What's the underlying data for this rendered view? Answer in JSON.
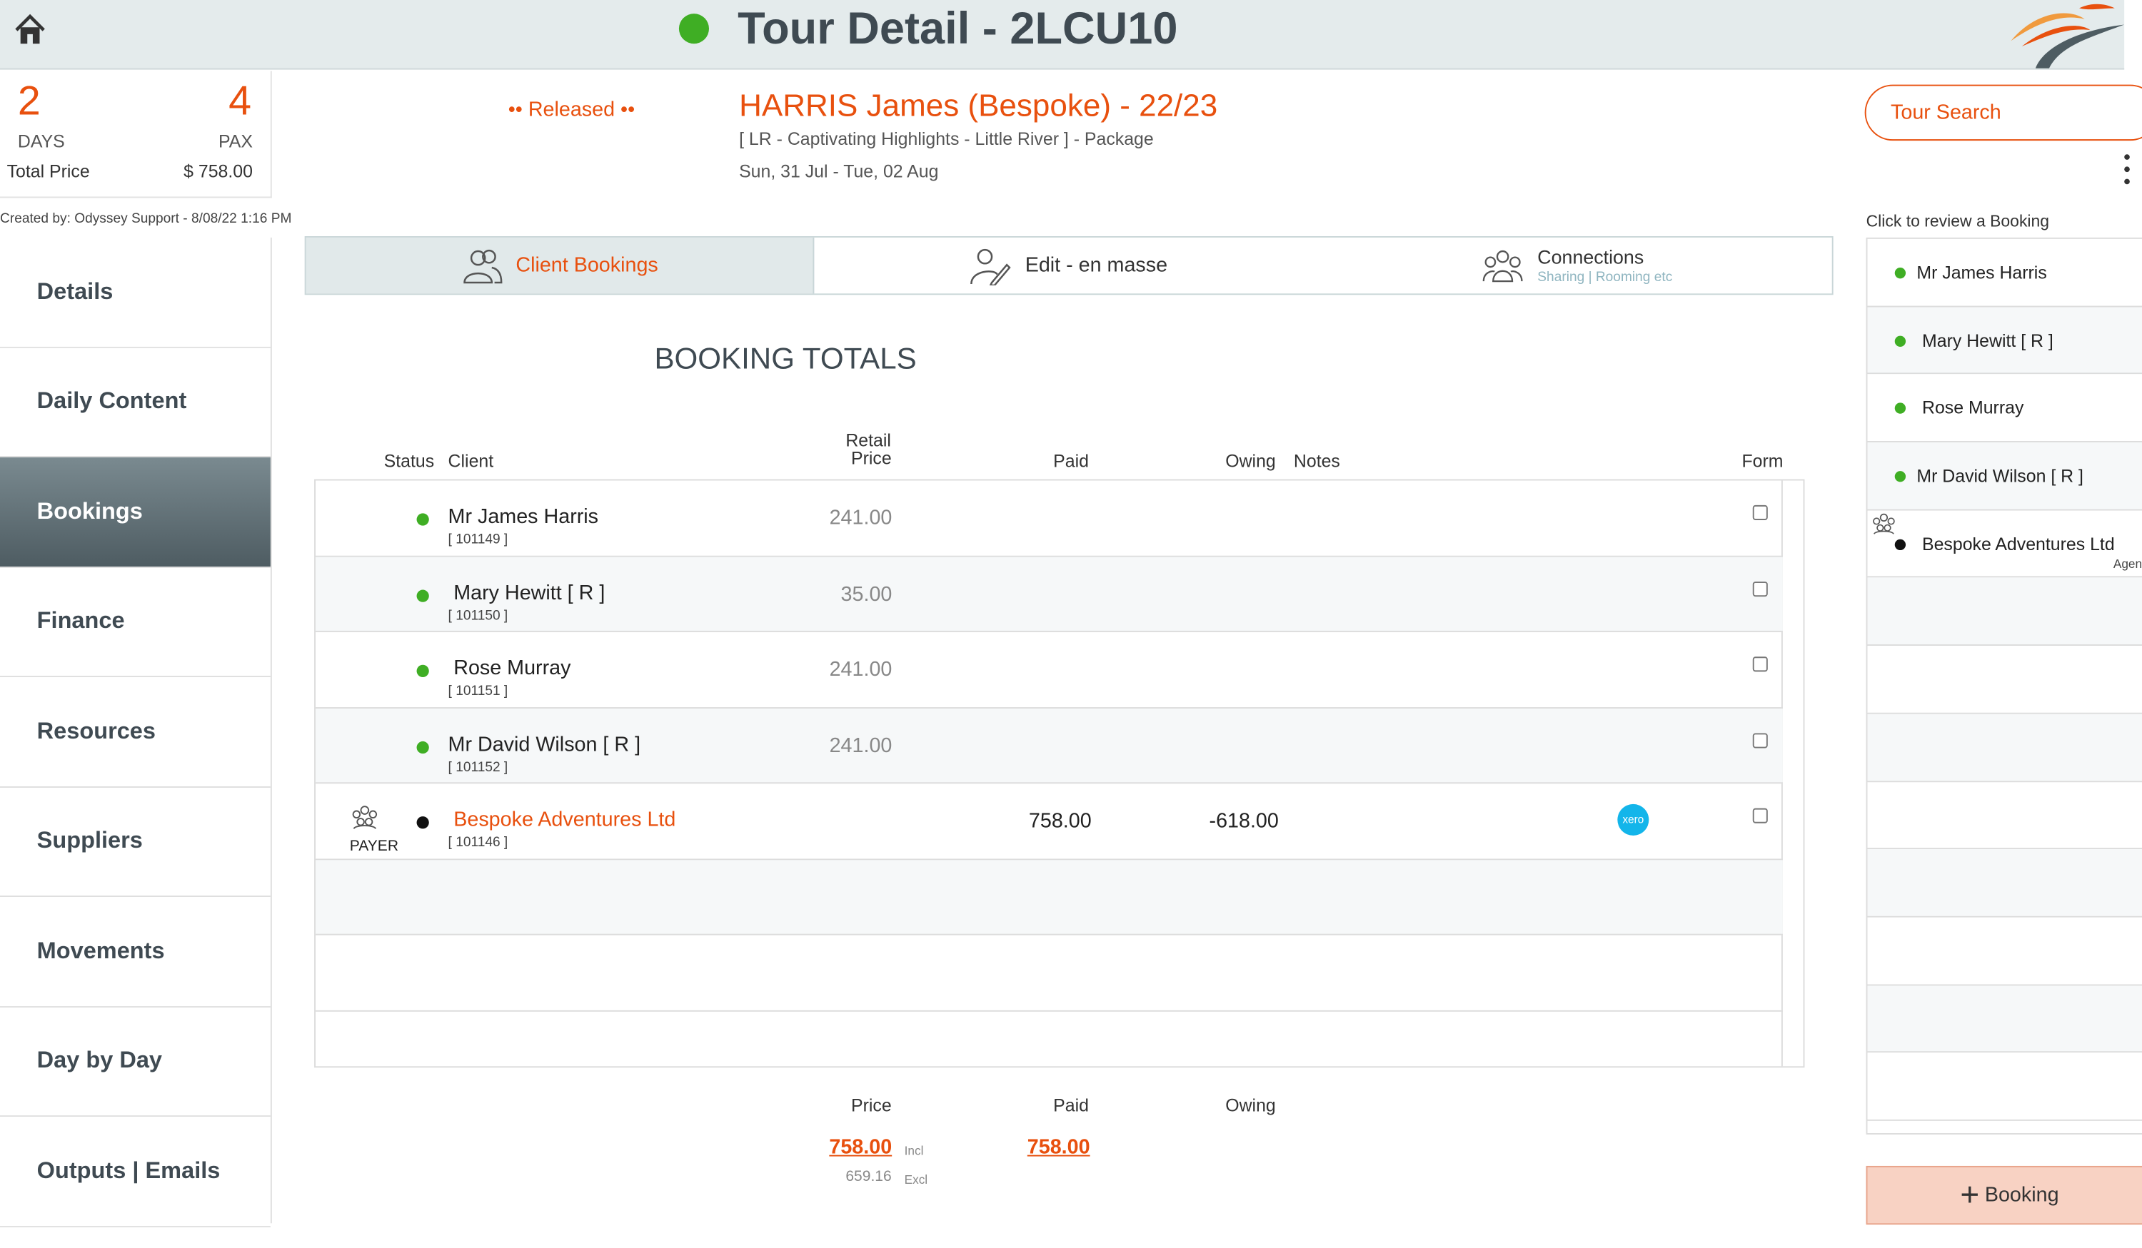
{
  "header": {
    "title": "Tour Detail - 2LCU10",
    "status_color": "#3fae24"
  },
  "summary": {
    "days": "2",
    "days_label": "DAYS",
    "pax": "4",
    "pax_label": "PAX",
    "total_price_label": "Total Price",
    "total_price_value": "$ 758.00",
    "created_by": "Created by: Odyssey Support - 8/08/22 1:16 PM"
  },
  "sidebar": {
    "items": [
      {
        "label": "Details"
      },
      {
        "label": "Daily Content"
      },
      {
        "label": "Bookings"
      },
      {
        "label": "Finance"
      },
      {
        "label": "Resources"
      },
      {
        "label": "Suppliers"
      },
      {
        "label": "Movements"
      },
      {
        "label": "Day by Day"
      },
      {
        "label": "Outputs | Emails"
      }
    ],
    "active": "Bookings"
  },
  "tour": {
    "status": "•• Released ••",
    "name": "HARRIS James (Bespoke) - 22/23",
    "subtitle": "[ LR - Captivating Highlights - Little River ] - Package",
    "dates": "Sun, 31 Jul  - Tue, 02 Aug"
  },
  "tabs": {
    "client_bookings": "Client Bookings",
    "edit_en_masse": "Edit - en masse",
    "connections": "Connections",
    "connections_sub": "Sharing | Rooming etc"
  },
  "booking_totals_title": "BOOKING TOTALS",
  "table": {
    "headers": {
      "status": "Status",
      "client": "Client",
      "retail_line1": "Retail",
      "retail_line2": "Price",
      "paid": "Paid",
      "owing": "Owing",
      "notes": "Notes",
      "form": "Form"
    },
    "rows": [
      {
        "name": "Mr James Harris",
        "id": "[ 101149 ]",
        "price": "241.00",
        "paid": "",
        "owing": "",
        "status_color": "#3fae24"
      },
      {
        "name": "Mary Hewitt  [ R ]",
        "id": "[ 101150 ]",
        "price": "35.00",
        "paid": "",
        "owing": "",
        "status_color": "#3fae24"
      },
      {
        "name": "Rose Murray",
        "id": "[ 101151 ]",
        "price": "241.00",
        "paid": "",
        "owing": "",
        "status_color": "#3fae24"
      },
      {
        "name": "Mr David Wilson  [ R ]",
        "id": "[ 101152 ]",
        "price": "241.00",
        "paid": "",
        "owing": "",
        "status_color": "#3fae24"
      },
      {
        "name": "Bespoke Adventures Ltd",
        "id": "[ 101146 ]",
        "price": "",
        "paid": "758.00",
        "owing": "-618.00",
        "status_color": "#111111",
        "payer_label": "PAYER",
        "xero_label": "xero"
      }
    ]
  },
  "totals": {
    "price_label": "Price",
    "paid_label": "Paid",
    "owing_label": "Owing",
    "price_incl": "758.00",
    "incl_label": "Incl",
    "paid_value": "758.00",
    "price_excl": "659.16",
    "excl_label": "Excl"
  },
  "right": {
    "search_label": "Tour Search",
    "review_label": "Click to review a Booking",
    "bookings": [
      {
        "name": "Mr James Harris",
        "status_color": "#3fae24"
      },
      {
        "name": "Mary Hewitt  [ R ]",
        "status_color": "#3fae24"
      },
      {
        "name": "Rose Murray",
        "status_color": "#3fae24"
      },
      {
        "name": "Mr David Wilson  [ R ]",
        "status_color": "#3fae24"
      },
      {
        "name": "Bespoke Adventures Ltd",
        "status_color": "#111111",
        "agent_label": "Agent"
      }
    ],
    "add_booking_label": "Booking"
  },
  "colors": {
    "accent": "#e8500e",
    "active_nav": "#56656b"
  }
}
